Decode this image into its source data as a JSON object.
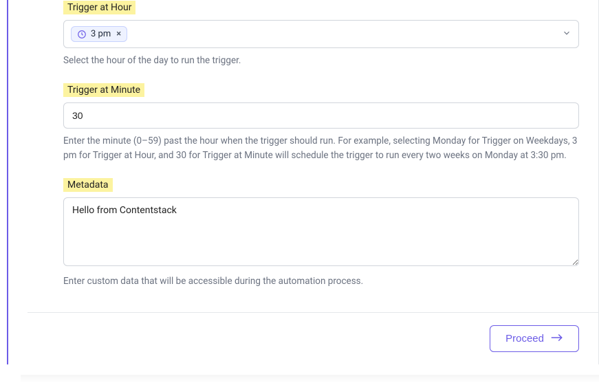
{
  "fields": {
    "hour": {
      "label": "Trigger at Hour",
      "chip": "3 pm",
      "help": "Select the hour of the day to run the trigger."
    },
    "minute": {
      "label": "Trigger at Minute",
      "value": "30",
      "help": "Enter the minute (0–59) past the hour when the trigger should run. For example, selecting Monday for Trigger on Weekdays, 3 pm for Trigger at Hour, and 30 for Trigger at Minute will schedule the trigger to run every two weeks on Monday at 3:30 pm."
    },
    "metadata": {
      "label": "Metadata",
      "value": "Hello from Contentstack",
      "help": "Enter custom data that will be accessible during the automation process."
    }
  },
  "footer": {
    "proceed": "Proceed"
  },
  "colors": {
    "accent": "#6c5ce7",
    "highlight": "#fcf3a0"
  }
}
